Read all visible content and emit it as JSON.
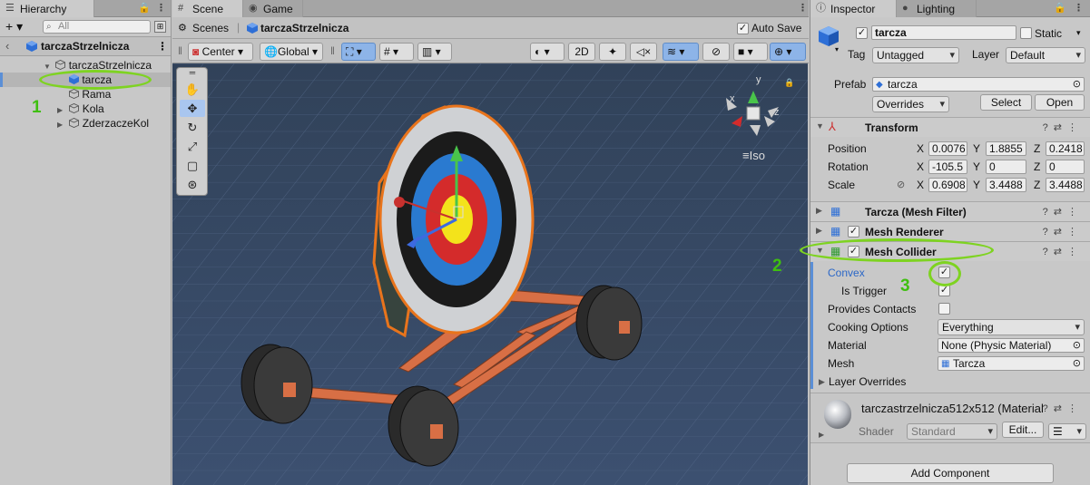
{
  "hierarchy": {
    "tab_label": "Hierarchy",
    "add_label": "+ ▾",
    "search_placeholder": "All",
    "scene_name": "tarczaStrzelnicza",
    "items": [
      {
        "label": "tarczaStrzelnicza"
      },
      {
        "label": "tarcza"
      },
      {
        "label": "Rama"
      },
      {
        "label": "Kola"
      },
      {
        "label": "ZderzaczeKol"
      }
    ],
    "annotation_number": "1"
  },
  "scene": {
    "tabs": [
      {
        "label": "Scene"
      },
      {
        "label": "Game"
      }
    ],
    "breadcrumb_root": "Scenes",
    "breadcrumb_current": "tarczaStrzelnicza",
    "auto_save_label": "Auto Save",
    "auto_save_checked": true,
    "pivot_label": "Center",
    "space_label": "Global",
    "mode_2d_label": "2D",
    "gizmo_view_label": "Iso",
    "gizmo_axes": {
      "x": "x",
      "y": "y",
      "z": "z"
    }
  },
  "inspector": {
    "tabs": [
      {
        "label": "Inspector"
      },
      {
        "label": "Lighting"
      }
    ],
    "object_name": "tarcza",
    "static_label": "Static",
    "tag_label": "Tag",
    "tag_value": "Untagged",
    "layer_label": "Layer",
    "layer_value": "Default",
    "prefab_label": "Prefab",
    "prefab_value": "tarcza",
    "overrides_label": "Overrides",
    "select_label": "Select",
    "open_label": "Open",
    "transform": {
      "title": "Transform",
      "position_label": "Position",
      "rotation_label": "Rotation",
      "scale_label": "Scale",
      "position": {
        "x": "0.0076",
        "y": "1.8855",
        "z": "0.2418"
      },
      "rotation": {
        "x": "-105.5",
        "y": "0",
        "z": "0"
      },
      "scale": {
        "x": "0.6908",
        "y": "3.4488",
        "z": "3.4488"
      }
    },
    "mesh_filter_title": "Tarcza (Mesh Filter)",
    "mesh_renderer_title": "Mesh Renderer",
    "mesh_collider": {
      "title": "Mesh Collider",
      "convex_label": "Convex",
      "convex_checked": true,
      "is_trigger_label": "Is Trigger",
      "is_trigger_checked": true,
      "provides_contacts_label": "Provides Contacts",
      "provides_contacts_checked": false,
      "cooking_options_label": "Cooking Options",
      "cooking_options_value": "Everything",
      "material_label": "Material",
      "material_value": "None (Physic Material)",
      "mesh_label": "Mesh",
      "mesh_value": "Tarcza",
      "layer_overrides_label": "Layer Overrides"
    },
    "material": {
      "title": "tarczastrzelnicza512x512 (Material",
      "shader_label": "Shader",
      "shader_value": "Standard",
      "edit_label": "Edit..."
    },
    "add_component_label": "Add Component",
    "annotation_numbers": [
      "2",
      "3"
    ]
  },
  "colors": {
    "selection_outline": "#e8741c",
    "annotation_green": "#7ed321",
    "scene_background": "#3a4c64",
    "toggle_active": "#8db4e8"
  }
}
